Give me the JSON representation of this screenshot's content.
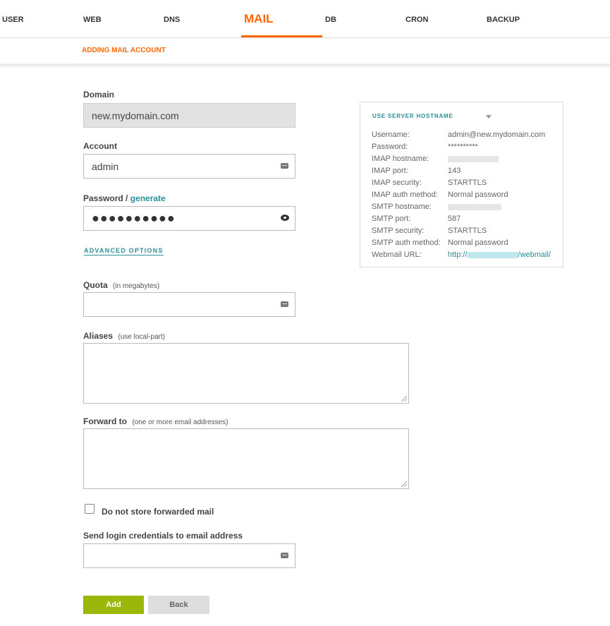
{
  "nav": {
    "tabs": [
      {
        "label": "USER"
      },
      {
        "label": "WEB"
      },
      {
        "label": "DNS"
      },
      {
        "label": "MAIL",
        "active": true
      },
      {
        "label": "DB"
      },
      {
        "label": "CRON"
      },
      {
        "label": "BACKUP"
      }
    ]
  },
  "page": {
    "subtitle": "ADDING MAIL ACCOUNT"
  },
  "form": {
    "domain_label": "Domain",
    "domain_value": "new.mydomain.com",
    "account_label": "Account",
    "account_value": "admin",
    "password_label": "Password /",
    "generate_label": "generate",
    "password_value": "●●●●●●●●●●",
    "advanced_options": "ADVANCED OPTIONS",
    "quota_label": "Quota",
    "quota_hint": "(in megabytes)",
    "quota_value": "",
    "aliases_label": "Aliases",
    "aliases_hint": "(use local-part)",
    "forward_label": "Forward to",
    "forward_hint": "(one or more email addresses)",
    "no_store_label": "Do not store forwarded mail",
    "no_store_checked": false,
    "send_credentials_label": "Send login credentials to email address",
    "send_credentials_value": "",
    "add_button": "Add",
    "back_button": "Back"
  },
  "info": {
    "title": "USE SERVER HOSTNAME",
    "rows": [
      {
        "key": "Username:",
        "value": "admin@new.mydomain.com"
      },
      {
        "key": "Password:",
        "value": "**********"
      },
      {
        "key": "IMAP hostname:",
        "value": ""
      },
      {
        "key": "IMAP port:",
        "value": "143"
      },
      {
        "key": "IMAP security:",
        "value": "STARTTLS"
      },
      {
        "key": "IMAP auth method:",
        "value": "Normal password"
      },
      {
        "key": "SMTP hostname:",
        "value": ""
      },
      {
        "key": "SMTP port:",
        "value": "587"
      },
      {
        "key": "SMTP security:",
        "value": "STARTTLS"
      },
      {
        "key": "SMTP auth method:",
        "value": "Normal password"
      },
      {
        "key": "Webmail URL:",
        "value_prefix": "http://",
        "value_suffix": "/webmail/"
      }
    ]
  },
  "colors": {
    "accent": "#ff6701",
    "link": "#2b8f97",
    "add_button": "#9ab70a"
  }
}
